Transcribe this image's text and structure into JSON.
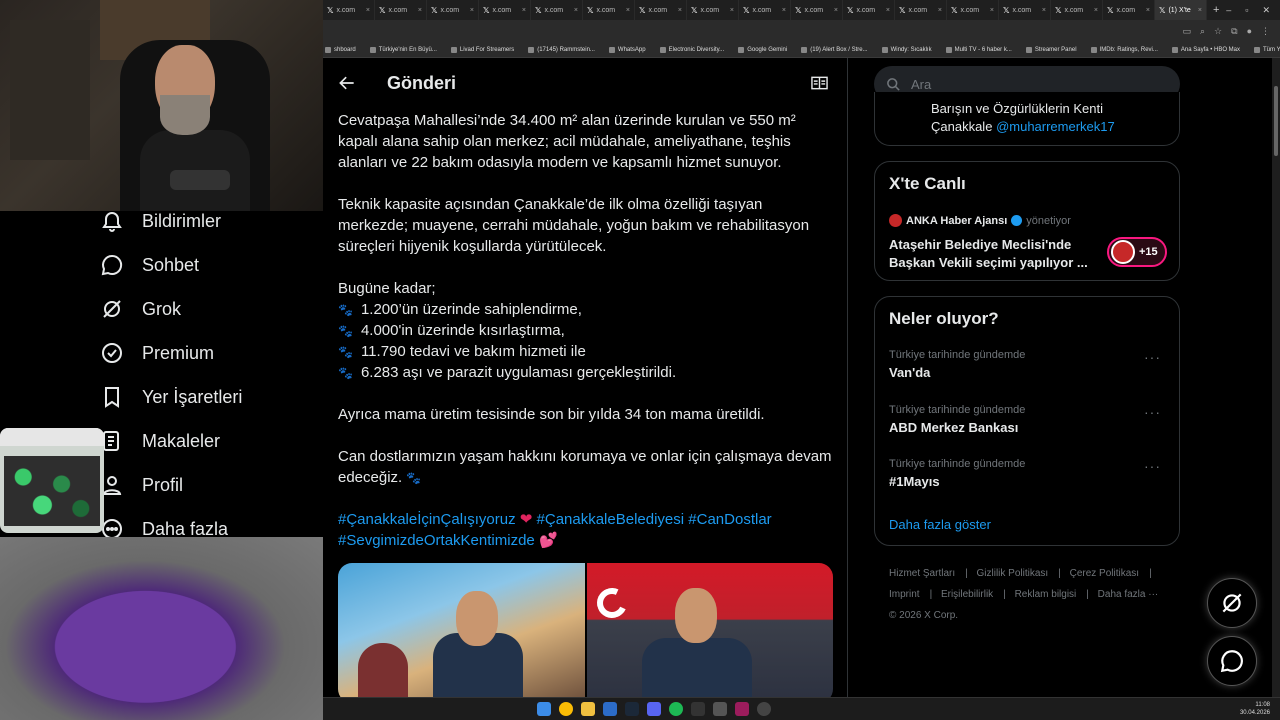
{
  "browser": {
    "tabs": [
      "x.com",
      "x.com",
      "x.com",
      "x.com",
      "x.com",
      "x.com",
      "x.com",
      "x.com",
      "x.com",
      "x.com",
      "x.com",
      "x.com",
      "x.com",
      "x.com",
      "x.com",
      "x.com",
      "(1) X'te"
    ],
    "bookmarks": [
      "shboard",
      "Türkiye'nin En Büyü...",
      "Livad For Streamers",
      "(17145) Rammstein...",
      "WhatsApp",
      "Electronic Diversity...",
      "Google Gemini",
      "(19) Alert Box / Stre...",
      "Windy: Sıcaklık",
      "Multi TV - 6 haber k...",
      "Streamer Panel",
      "IMDb: Ratings, Revi...",
      "Ana Sayfa • HBO Max",
      "Tüm Yer İşaretleri"
    ]
  },
  "nav": {
    "items": [
      "Bildirimler",
      "Sohbet",
      "Grok",
      "Premium",
      "Yer İşaretleri",
      "Makaleler",
      "Profil",
      "Daha fazla"
    ]
  },
  "post": {
    "header_title": "Gönderi",
    "paragraph1": "Cevatpaşa Mahallesi’nde 34.400 m² alan üzerinde kurulan ve 550 m² kapalı alana sahip olan merkez; acil müdahale, ameliyathane, teşhis alanları ve 22 bakım odasıyla modern ve kapsamlı hizmet sunuyor.",
    "paragraph2": "Teknik kapasite açısından Çanakkale’de ilk olma özelliği taşıyan merkezde; muayene, cerrahi müdahale, yoğun bakım ve rehabilitasyon süreçleri hijyenik koşullarda yürütülecek.",
    "list_intro": "Bugüne kadar;",
    "list": [
      "1.200’ün üzerinde sahiplendirme,",
      "4.000'in üzerinde kısırlaştırma,",
      "11.790 tedavi ve bakım hizmeti ile",
      "6.283 aşı ve parazit uygulaması gerçekleştirildi."
    ],
    "paragraph3": "Ayrıca mama üretim tesisinde son bir yılda 34 ton mama üretildi.",
    "paragraph4": "Can dostlarımızın yaşam hakkını korumaya ve onlar için çalışmaya devam edeceğiz.",
    "hashtags": [
      "#ÇanakkaleİçinÇalışıyoruz",
      "#ÇanakkaleBelediyesi",
      "#CanDostlar",
      "#SevgimizdeOrtakKentimizde"
    ]
  },
  "sidebar": {
    "search_placeholder": "Ara",
    "profile_bio_line1": "Barışın ve Özgürlüklerin Kenti",
    "profile_bio_line2": "Çanakkale",
    "profile_handle": "@muharremerkek17",
    "live": {
      "title": "X'te Canlı",
      "host": "ANKA Haber Ajansı",
      "role": "yönetiyor",
      "headline_line1": "Ataşehir Belediye Meclisi'nde",
      "headline_line2": "Başkan Vekili seçimi yapılıyor ...",
      "count": "+15"
    },
    "trending": {
      "title": "Neler oluyor?",
      "items": [
        {
          "meta": "Türkiye tarihinde gündemde",
          "name": "Van'da"
        },
        {
          "meta": "Türkiye tarihinde gündemde",
          "name": "ABD Merkez Bankası"
        },
        {
          "meta": "Türkiye tarihinde gündemde",
          "name": "#1Mayıs"
        }
      ],
      "show_more": "Daha fazla göster"
    },
    "footer": {
      "links": [
        "Hizmet Şartları",
        "Gizlilik Politikası",
        "Çerez Politikası",
        "Imprint",
        "Erişilebilirlik",
        "Reklam bilgisi",
        "Daha fazla ···"
      ],
      "copyright": "© 2026 X Corp."
    }
  },
  "taskbar": {
    "time": "11:08",
    "date": "30.04.2026"
  }
}
